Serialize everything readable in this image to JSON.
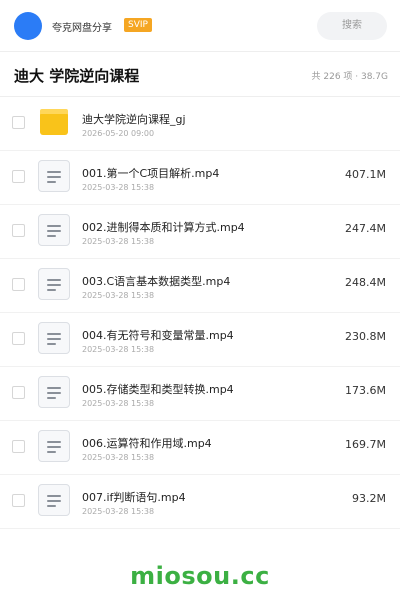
{
  "header": {
    "app_name": "夸克网盘分享",
    "badge": "SVIP",
    "search_placeholder": "搜索",
    "avatar_color": "#2b7cf6"
  },
  "title": "迪大 学院逆向课程",
  "summary": "共 226 项 · 38.7G",
  "items": [
    {
      "type": "folder",
      "icon": "folder-icon",
      "name": "迪大学院逆向课程_gj",
      "date": "2026-05-20 09:00",
      "size": ""
    },
    {
      "type": "file",
      "icon": "file-icon",
      "name": "001.第一个C项目解析.mp4",
      "date": "2025-03-28 15:38",
      "size": "407.1M"
    },
    {
      "type": "file",
      "icon": "file-icon",
      "name": "002.进制得本质和计算方式.mp4",
      "date": "2025-03-28 15:38",
      "size": "247.4M"
    },
    {
      "type": "file",
      "icon": "file-icon",
      "name": "003.C语言基本数据类型.mp4",
      "date": "2025-03-28 15:38",
      "size": "248.4M"
    },
    {
      "type": "file",
      "icon": "file-icon",
      "name": "004.有无符号和变量常量.mp4",
      "date": "2025-03-28 15:38",
      "size": "230.8M"
    },
    {
      "type": "file",
      "icon": "file-icon",
      "name": "005.存储类型和类型转换.mp4",
      "date": "2025-03-28 15:38",
      "size": "173.6M"
    },
    {
      "type": "file",
      "icon": "file-icon",
      "name": "006.运算符和作用域.mp4",
      "date": "2025-03-28 15:38",
      "size": "169.7M"
    },
    {
      "type": "file",
      "icon": "file-icon",
      "name": "007.if判断语句.mp4",
      "date": "2025-03-28 15:38",
      "size": "93.2M"
    }
  ],
  "watermark": "miosou.cc",
  "colors": {
    "svip": "#f5a623",
    "folder": "#f9c31a",
    "watermark": "#3cb043"
  }
}
